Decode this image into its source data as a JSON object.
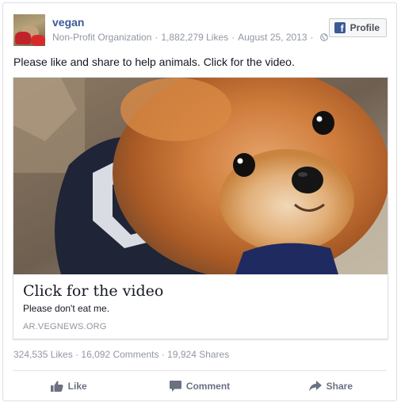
{
  "page": {
    "name": "vegan",
    "category": "Non-Profit Organization",
    "likes": "1,882,279 Likes",
    "date": "August 25, 2013"
  },
  "profile_button": {
    "label": "Profile",
    "icon": "facebook-f-icon"
  },
  "post": {
    "text": "Please like and share to help animals. Click for the video."
  },
  "attachment": {
    "title": "Click for the video",
    "description": "Please don't eat me.",
    "domain": "AR.VEGNEWS.ORG"
  },
  "stats": {
    "likes": "324,535 Likes",
    "comments": "16,092 Comments",
    "shares": "19,924 Shares"
  },
  "actions": {
    "like": "Like",
    "comment": "Comment",
    "share": "Share"
  },
  "colors": {
    "brand_blue": "#3b5998",
    "meta_gray": "#9197a3",
    "action_gray": "#6a7180"
  }
}
